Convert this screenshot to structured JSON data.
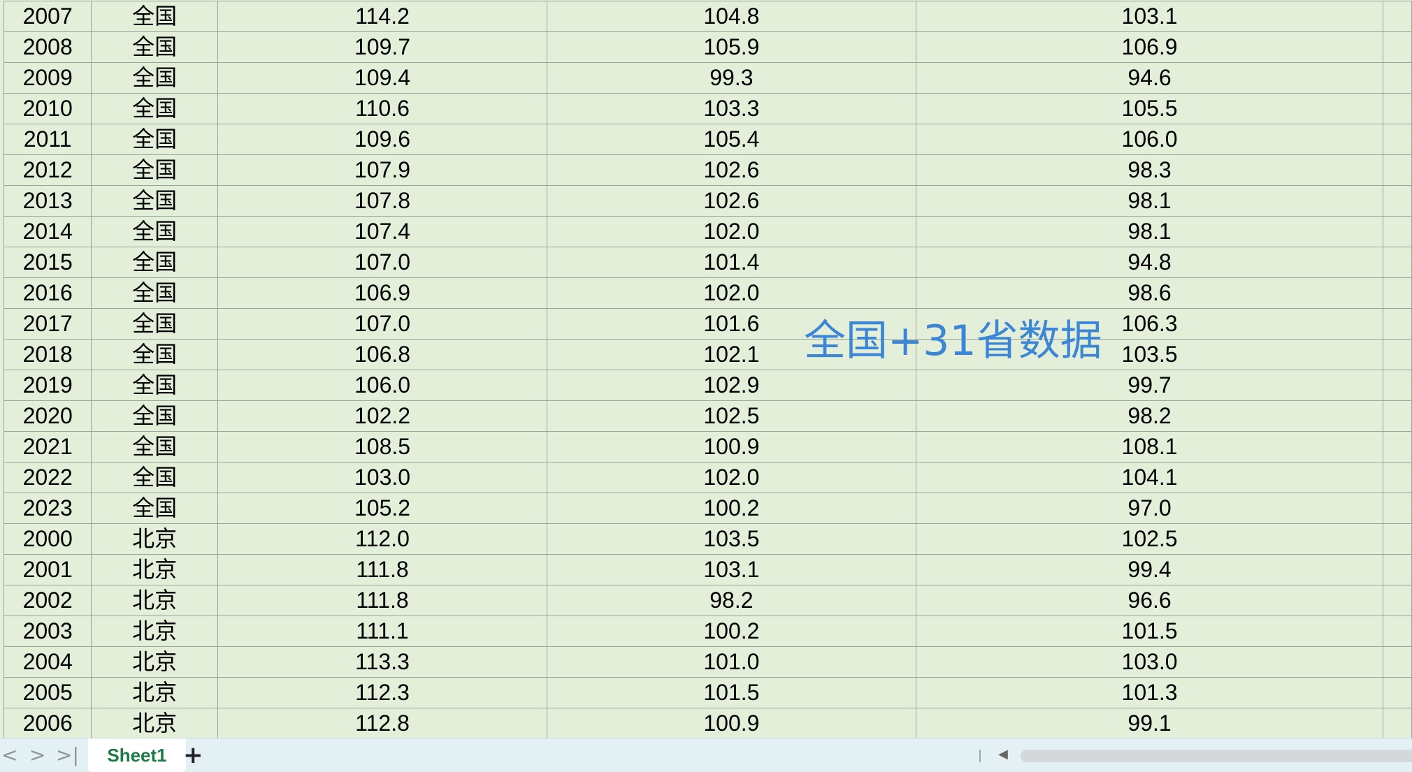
{
  "rows": [
    [
      "2007",
      "全国",
      "114.2",
      "104.8",
      "103.1"
    ],
    [
      "2008",
      "全国",
      "109.7",
      "105.9",
      "106.9"
    ],
    [
      "2009",
      "全国",
      "109.4",
      "99.3",
      "94.6"
    ],
    [
      "2010",
      "全国",
      "110.6",
      "103.3",
      "105.5"
    ],
    [
      "2011",
      "全国",
      "109.6",
      "105.4",
      "106.0"
    ],
    [
      "2012",
      "全国",
      "107.9",
      "102.6",
      "98.3"
    ],
    [
      "2013",
      "全国",
      "107.8",
      "102.6",
      "98.1"
    ],
    [
      "2014",
      "全国",
      "107.4",
      "102.0",
      "98.1"
    ],
    [
      "2015",
      "全国",
      "107.0",
      "101.4",
      "94.8"
    ],
    [
      "2016",
      "全国",
      "106.9",
      "102.0",
      "98.6"
    ],
    [
      "2017",
      "全国",
      "107.0",
      "101.6",
      "106.3"
    ],
    [
      "2018",
      "全国",
      "106.8",
      "102.1",
      "103.5"
    ],
    [
      "2019",
      "全国",
      "106.0",
      "102.9",
      "99.7"
    ],
    [
      "2020",
      "全国",
      "102.2",
      "102.5",
      "98.2"
    ],
    [
      "2021",
      "全国",
      "108.5",
      "100.9",
      "108.1"
    ],
    [
      "2022",
      "全国",
      "103.0",
      "102.0",
      "104.1"
    ],
    [
      "2023",
      "全国",
      "105.2",
      "100.2",
      "97.0"
    ],
    [
      "2000",
      "北京",
      "112.0",
      "103.5",
      "102.5"
    ],
    [
      "2001",
      "北京",
      "111.8",
      "103.1",
      "99.4"
    ],
    [
      "2002",
      "北京",
      "111.8",
      "98.2",
      "96.6"
    ],
    [
      "2003",
      "北京",
      "111.1",
      "100.2",
      "101.5"
    ],
    [
      "2004",
      "北京",
      "113.3",
      "101.0",
      "103.0"
    ],
    [
      "2005",
      "北京",
      "112.3",
      "101.5",
      "101.3"
    ],
    [
      "2006",
      "北京",
      "112.8",
      "100.9",
      "99.1"
    ]
  ],
  "watermark": "全国+31省数据",
  "tabbar": {
    "nav_first": "<",
    "nav_next": ">",
    "nav_last": ">|",
    "sheet_name": "Sheet1",
    "add_sheet": "+"
  },
  "colors": {
    "sheet_background": "#e3efd9",
    "watermark": "#3d86d6",
    "active_tab_text": "#1c7a45"
  }
}
